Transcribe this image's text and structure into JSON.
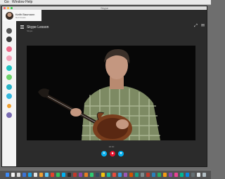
{
  "menubar": {
    "items": [
      "Go",
      "Window",
      "Help"
    ]
  },
  "window": {
    "title": "Skype"
  },
  "profile": {
    "name": "Keith Baumann",
    "status": "Not Create"
  },
  "call": {
    "title": "Skype Lesson",
    "subtitle": "Skype",
    "status": "00:00"
  },
  "colors": {
    "accent": "#00aff0",
    "hangup": "#e8112d",
    "sidebar_icons": [
      "#555555",
      "#3a3a3a",
      "#f06b8b",
      "#f4a3b9",
      "#1ec5c3",
      "#6ed36b",
      "#28b4c8",
      "#35b9e0",
      "#f0a030",
      "#7a6cb2"
    ]
  }
}
